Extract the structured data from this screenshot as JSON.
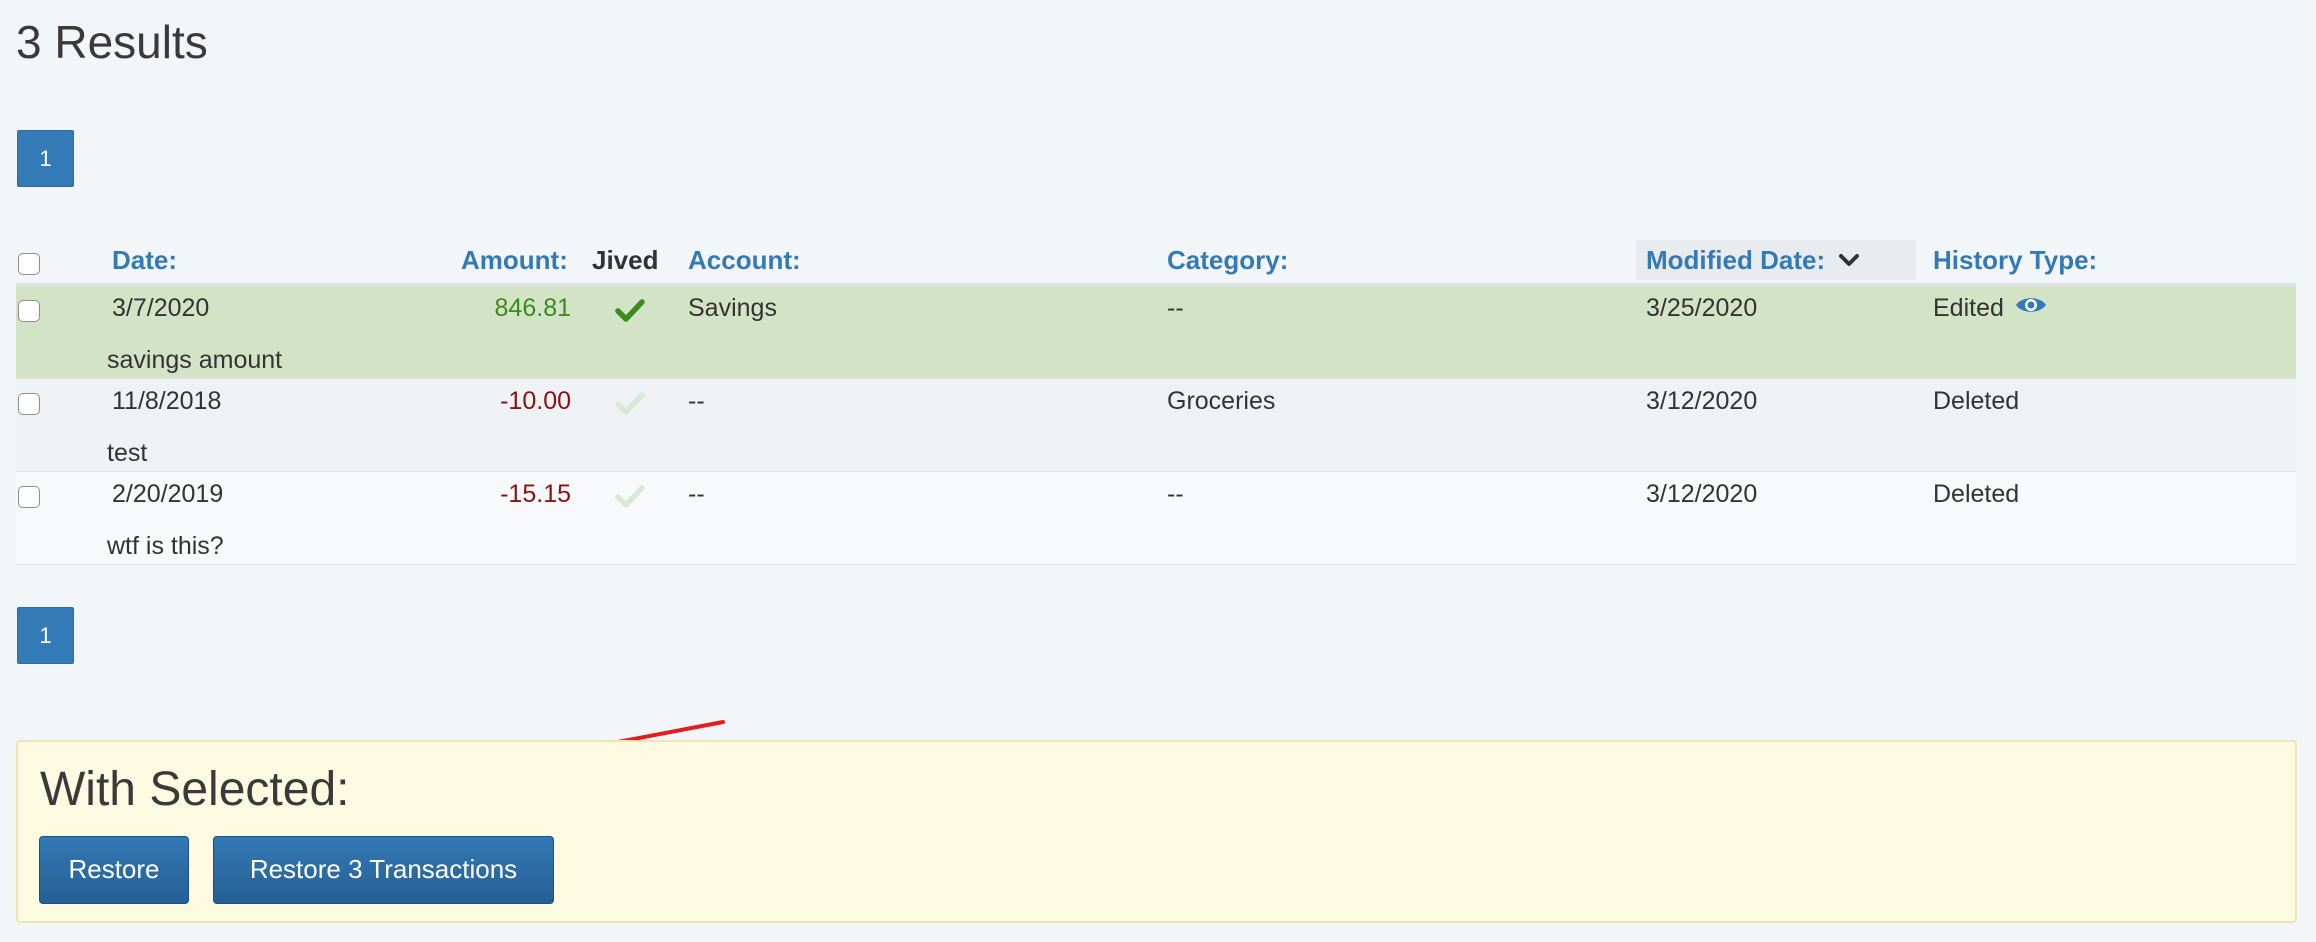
{
  "results_title": "3 Results",
  "pagination": {
    "page": "1"
  },
  "columns": {
    "date": "Date:",
    "amount": "Amount:",
    "jived": "Jived",
    "account": "Account:",
    "category": "Category:",
    "modified_date": "Modified Date:",
    "history_type": "History Type:"
  },
  "rows": [
    {
      "date": "3/7/2020",
      "amount": "846.81",
      "jived": true,
      "account": "Savings",
      "category": "--",
      "modified_date": "3/25/2020",
      "history_type": "Edited",
      "note": "savings amount"
    },
    {
      "date": "11/8/2018",
      "amount": "-10.00",
      "jived": false,
      "account": "--",
      "category": "Groceries",
      "modified_date": "3/12/2020",
      "history_type": "Deleted",
      "note": "test"
    },
    {
      "date": "2/20/2019",
      "amount": "-15.15",
      "jived": false,
      "account": "--",
      "category": "--",
      "modified_date": "3/12/2020",
      "history_type": "Deleted",
      "note": "wtf is this?"
    }
  ],
  "with_selected": {
    "title": "With Selected:",
    "restore_label": "Restore",
    "restore_all_label": "Restore 3 Transactions"
  },
  "colors": {
    "accent": "#337ab7",
    "positive": "#3c8a1e",
    "negative": "#8b1010",
    "selected_row": "#d3e3c6",
    "panel": "#fdfae2",
    "arrow": "#e51c1c"
  },
  "icons": {
    "sort": "chevron-down-icon",
    "jived": "check-icon",
    "view": "eye-icon",
    "annotation": "red-arrow"
  }
}
